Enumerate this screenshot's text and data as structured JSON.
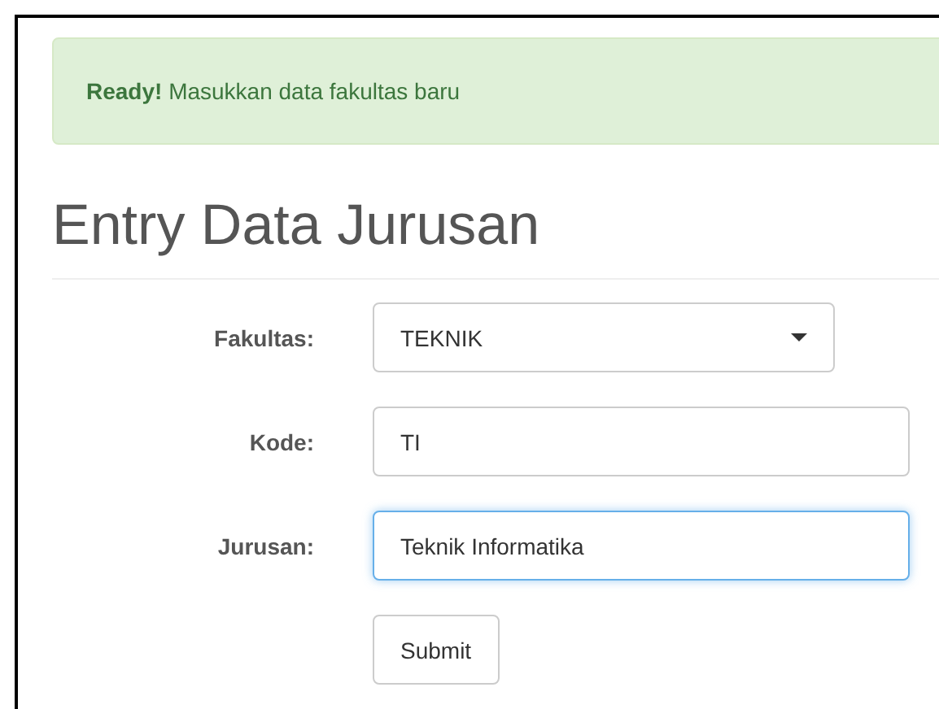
{
  "alert": {
    "kind": "success",
    "text": "**Ready!** Masukkan data fakultas baru"
  },
  "heading": "Entry Data Jurusan",
  "form": {
    "fields": [
      {
        "kind": "select",
        "label": "Fakultas:",
        "value": "TEKNIK",
        "focused": false
      },
      {
        "kind": "text",
        "label": "Kode:",
        "value": "TI",
        "focused": false
      },
      {
        "kind": "text",
        "label": "Jurusan:",
        "value": "Teknik Informatika",
        "focused": true
      }
    ],
    "submit": "Submit"
  }
}
